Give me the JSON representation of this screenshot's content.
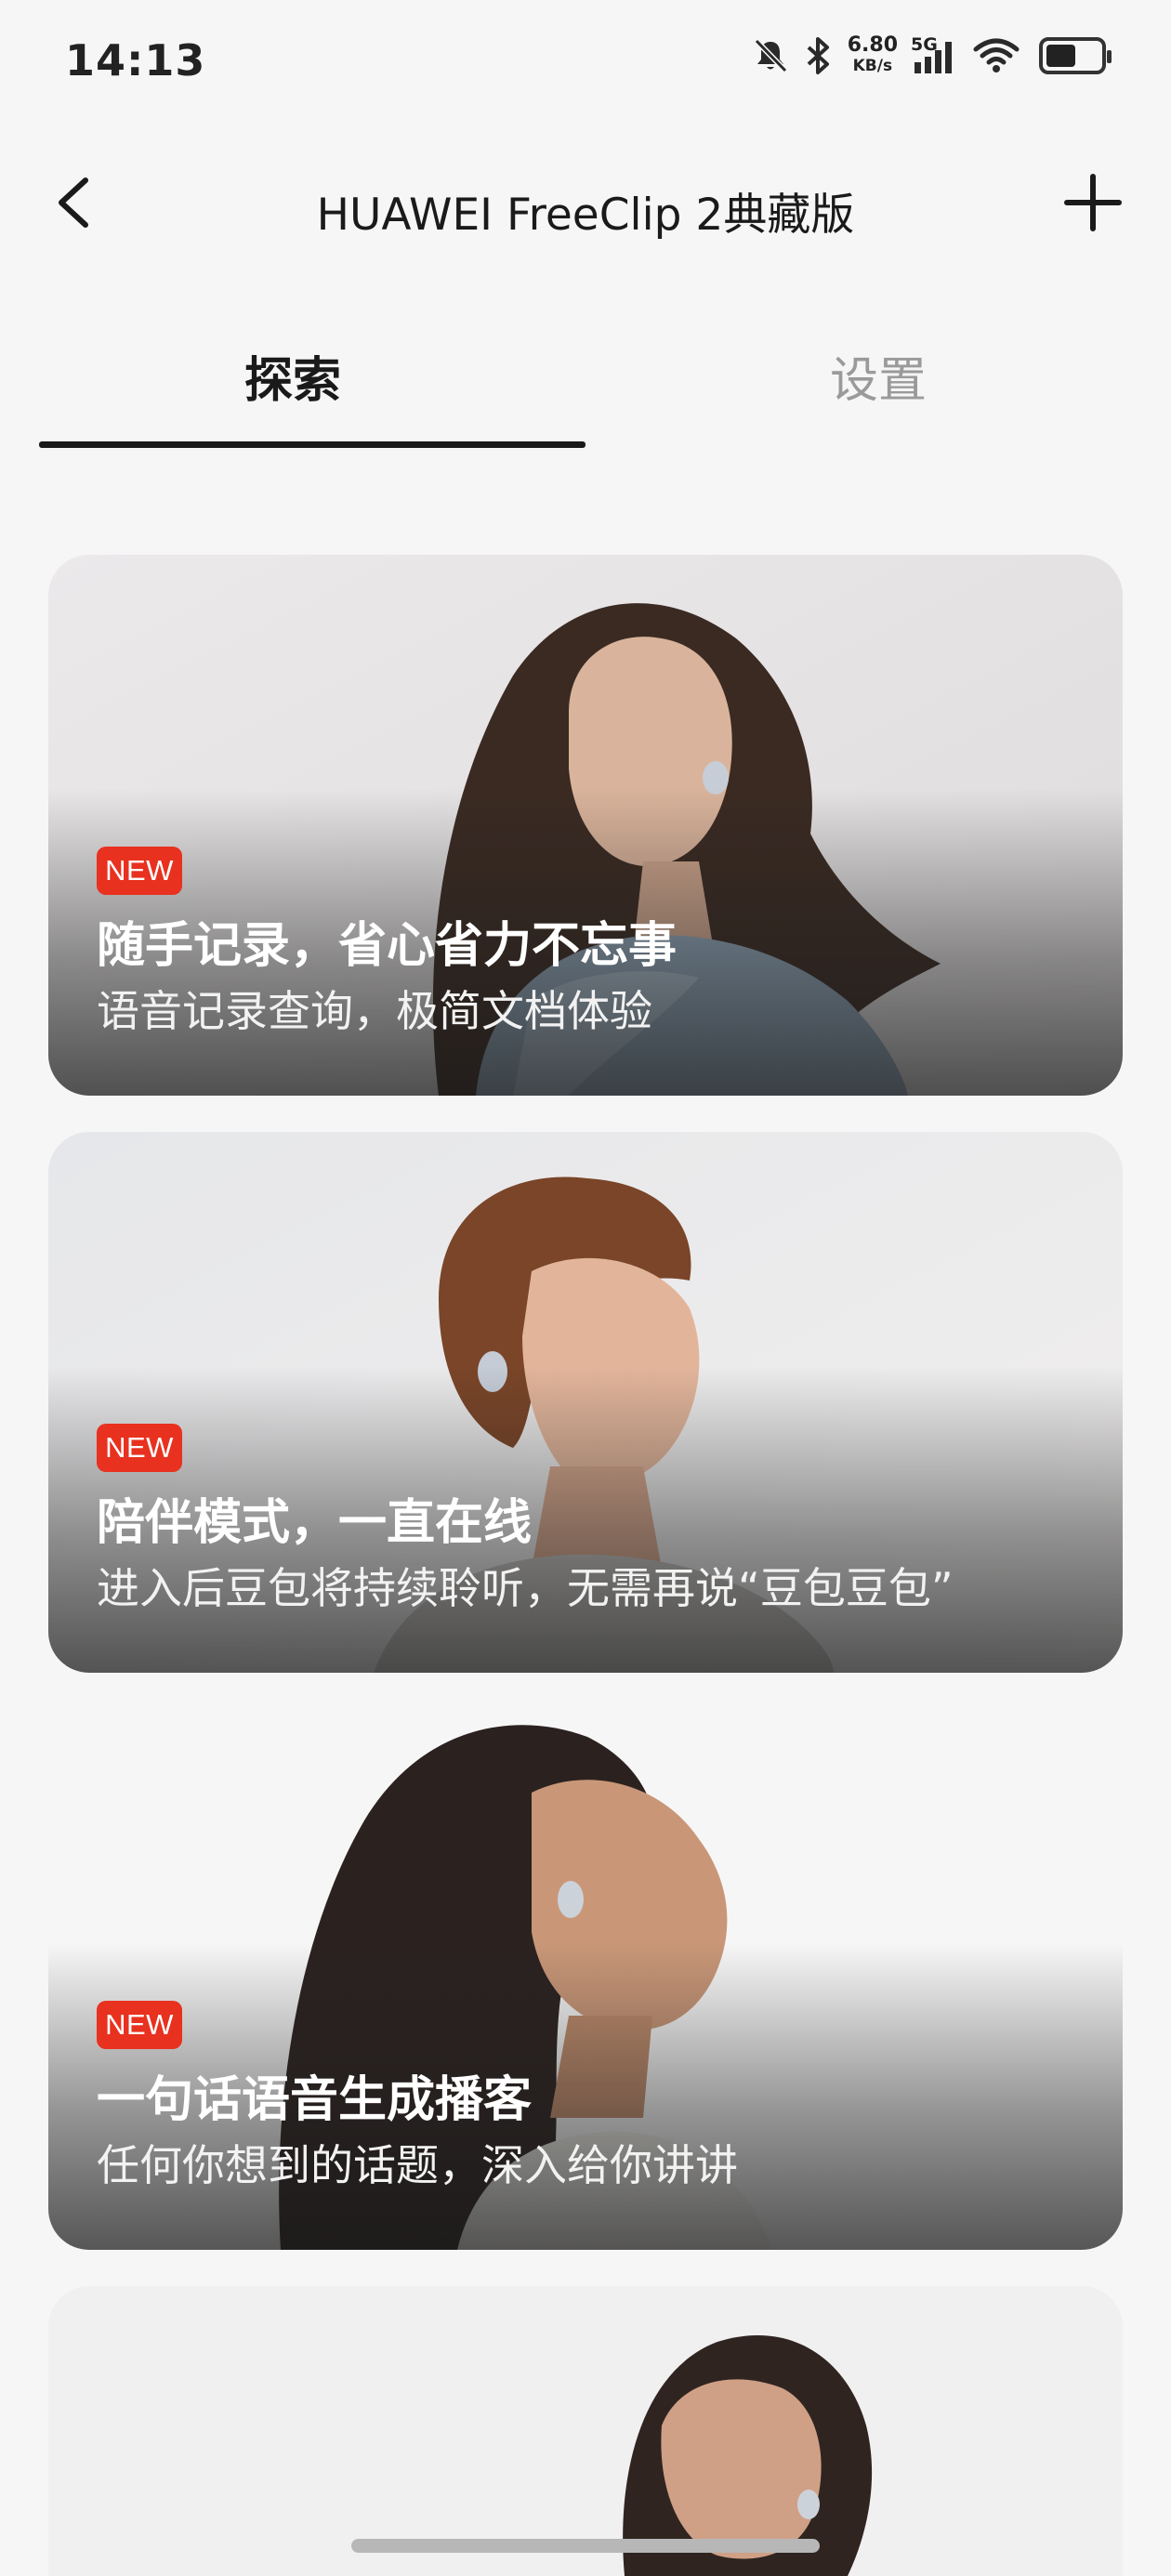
{
  "status_bar": {
    "time": "14:13",
    "speed_value": "6.80",
    "speed_unit": "KB/s",
    "network": "5G",
    "battery_percent": 55,
    "icons": [
      "bell-muted-icon",
      "bluetooth-icon",
      "signal-icon",
      "wifi-icon",
      "battery-icon"
    ]
  },
  "header": {
    "title": "HUAWEI FreeClip 2典藏版",
    "back_icon": "chevron-left-icon",
    "add_icon": "plus-icon"
  },
  "tabs": [
    {
      "label": "探索",
      "active": true
    },
    {
      "label": "设置",
      "active": false
    }
  ],
  "cards": [
    {
      "badge": "NEW",
      "title": "随手记录，省心省力不忘事",
      "subtitle": "语音记录查询，极简文档体验"
    },
    {
      "badge": "NEW",
      "title": "陪伴模式，一直在线",
      "subtitle": "进入后豆包将持续聆听，无需再说“豆包豆包”"
    },
    {
      "badge": "NEW",
      "title": "一句话语音生成播客",
      "subtitle": "任何你想到的话题，深入给你讲讲"
    }
  ],
  "colors": {
    "badge": "#e8311f",
    "background": "#f6f6f6",
    "tab_active": "#1a1a1a",
    "tab_inactive": "#9a9a9a"
  }
}
